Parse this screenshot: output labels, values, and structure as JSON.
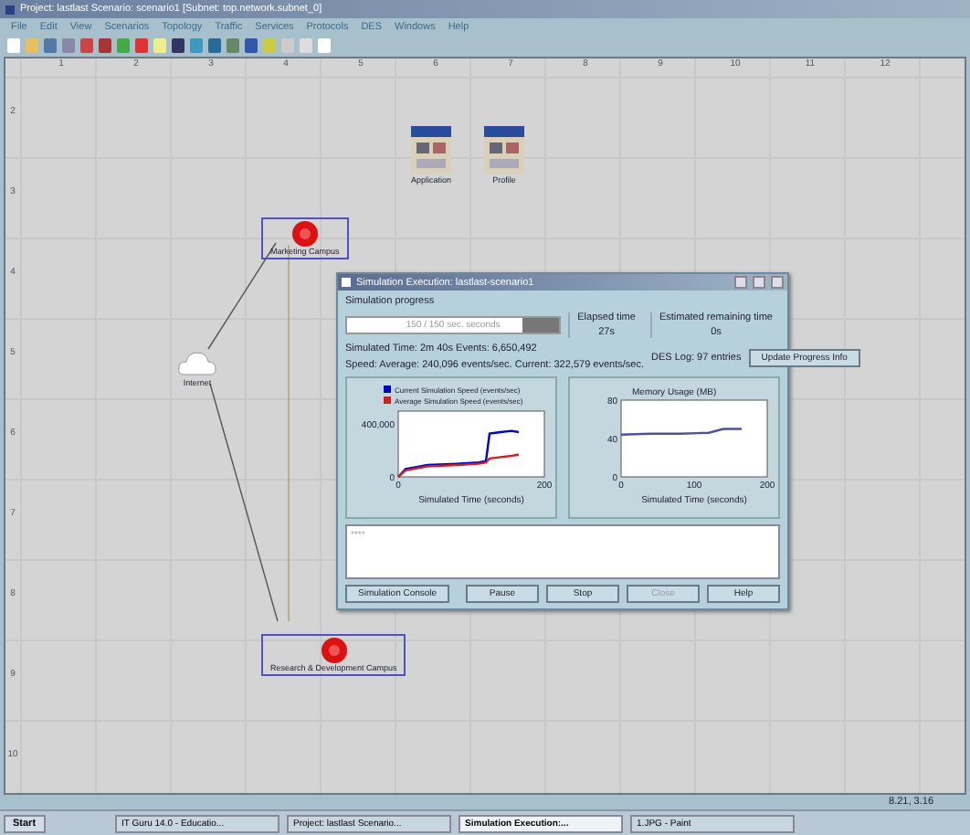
{
  "window": {
    "title": "Project: lastlast Scenario: scenario1 [Subnet: top.network.subnet_0]"
  },
  "menu": [
    "File",
    "Edit",
    "View",
    "Scenarios",
    "Topology",
    "Traffic",
    "Services",
    "Protocols",
    "DES",
    "Windows",
    "Help"
  ],
  "ruler": {
    "columns": [
      "1",
      "2",
      "3",
      "4",
      "5",
      "6",
      "7",
      "8",
      "9",
      "10",
      "11",
      "12"
    ],
    "rows": [
      "2",
      "3",
      "4",
      "5",
      "6",
      "7",
      "8",
      "9",
      "10"
    ]
  },
  "nodes": [
    {
      "kind": "config",
      "label": "Application"
    },
    {
      "kind": "config",
      "label": "Profile"
    },
    {
      "kind": "campus",
      "label": "Marketing Campus",
      "selected": true
    },
    {
      "kind": "cloud",
      "label": "Internet"
    },
    {
      "kind": "campus",
      "label": "Research & Development Campus",
      "selected": true
    }
  ],
  "dialog": {
    "title": "Simulation Execution: lastlast-scenario1",
    "progress_label": "Simulation progress",
    "progress": {
      "text": "150 / 150 sec. seconds",
      "level": 0.83
    },
    "elapsed": {
      "label": "Elapsed time",
      "value": "27s"
    },
    "remaining": {
      "label": "Estimated remaining time",
      "value": "0s"
    },
    "simulated": "Simulated Time:  2m 40s   Events:  6,650,492",
    "speed": "Speed: Average:  240,096  events/sec.  Current:  322,579  events/sec.",
    "des_log": "DES Log: 97 entries",
    "update_button": "Update Progress Info",
    "speed_chart": {
      "chart_data": {
        "type": "line",
        "legend": true,
        "xlabel": "Simulated Time (seconds)",
        "xlim": [
          0,
          200
        ],
        "ylim": [
          0,
          500000
        ],
        "xticks": [
          0,
          200
        ],
        "yticks": [
          0,
          {
            "value": 400000,
            "label": "400,000"
          }
        ],
        "series": [
          {
            "name": "Current Simulation Speed (events/sec)",
            "color": "#0000cc",
            "values": [
              0,
              60000,
              90000,
              100000,
              110000,
              120000,
              330000,
              340000,
              350000,
              340000
            ]
          },
          {
            "name": "Average Simulation Speed (events/sec)",
            "color": "#cc2222",
            "values": [
              0,
              50000,
              80000,
              90000,
              100000,
              110000,
              140000,
              150000,
              160000,
              170000
            ]
          }
        ],
        "x": [
          0,
          10,
          40,
          80,
          110,
          120,
          125,
          140,
          155,
          165
        ]
      }
    },
    "memory_chart": {
      "chart_data": {
        "type": "line",
        "xlabel": "Simulated Time (seconds)",
        "xlim": [
          0,
          200
        ],
        "ylim": [
          0,
          80
        ],
        "xticks": [
          0,
          100,
          200
        ],
        "yticks": [
          0,
          40,
          80
        ],
        "series": [
          {
            "name": "Memory Usage (MB)",
            "color": "#5050a0",
            "values": [
              44,
              45,
              45,
              46,
              50,
              50
            ]
          }
        ],
        "x": [
          0,
          40,
          80,
          120,
          140,
          165
        ]
      }
    },
    "console_text": "****",
    "buttons": [
      {
        "label": "Simulation Console",
        "disabled": false
      },
      {
        "label": "Pause",
        "disabled": false
      },
      {
        "label": "Stop",
        "disabled": false
      },
      {
        "label": "Close",
        "disabled": true
      },
      {
        "label": "Help",
        "disabled": false
      }
    ]
  },
  "coordinates": "8.21, 3.16",
  "taskbar": {
    "start": "Start",
    "tasks": [
      {
        "label": "IT Guru 14.0 - Educatio...",
        "selected": false
      },
      {
        "label": "Project: lastlast Scenario...",
        "selected": false
      },
      {
        "label": "Simulation Execution:...",
        "selected": true
      },
      {
        "label": "1.JPG - Paint",
        "selected": false
      }
    ]
  }
}
